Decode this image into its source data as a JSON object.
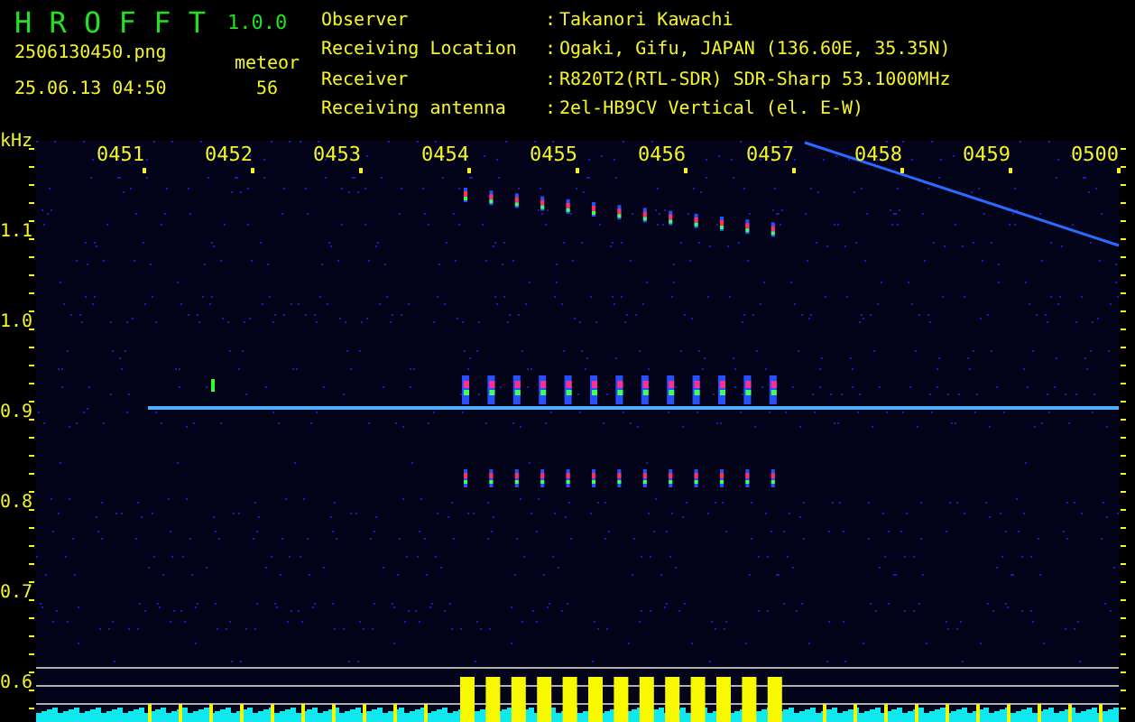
{
  "header": {
    "title": "H R O F F T",
    "version": "1.0.0",
    "filename": "2506130450.png",
    "datetime": "25.06.13 04:50",
    "meteor_label": "meteor",
    "meteor_count": "56",
    "info": [
      {
        "label": "Observer",
        "separator": ":",
        "value": "Takanori Kawachi"
      },
      {
        "label": "Receiving Location",
        "separator": ":",
        "value": "Ogaki, Gifu, JAPAN (136.60E, 35.35N)"
      },
      {
        "label": "Receiver",
        "separator": ":",
        "value": "R820T2(RTL-SDR) SDR-Sharp 53.1000MHz"
      },
      {
        "label": "Receiving antenna",
        "separator": ":",
        "value": "2el-HB9CV Vertical (el. E-W)"
      }
    ]
  },
  "plot": {
    "unit": "kHz",
    "time_labels": [
      "0451",
      "0452",
      "0453",
      "0454",
      "0455",
      "0456",
      "0457",
      "0458",
      "0459",
      "0500"
    ],
    "freq_labels": [
      "1.1",
      "1.0",
      "0.9",
      "0.8",
      "0.7",
      "0.6"
    ]
  }
}
